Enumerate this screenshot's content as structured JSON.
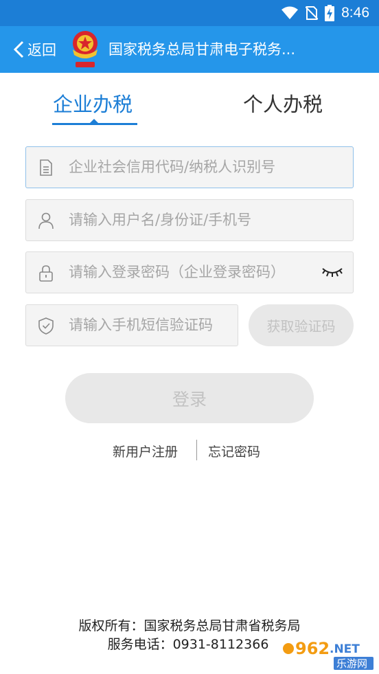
{
  "status": {
    "time": "8:46"
  },
  "header": {
    "back_label": "返回",
    "title": "国家税务总局甘肃电子税务..."
  },
  "tabs": [
    {
      "label": "企业办税",
      "active": true
    },
    {
      "label": "个人办税",
      "active": false
    }
  ],
  "form": {
    "credit_code_placeholder": "企业社会信用代码/纳税人识别号",
    "username_placeholder": "请输入用户名/身份证/手机号",
    "password_placeholder": "请输入登录密码（企业登录密码）",
    "sms_placeholder": "请输入手机短信验证码",
    "sms_button": "获取验证码",
    "login_button": "登录"
  },
  "links": {
    "register": "新用户注册",
    "forgot": "忘记密码"
  },
  "footer": {
    "copyright": "版权所有：国家税务总局甘肃省税务局",
    "phone": "服务电话：0931-8112366"
  },
  "watermark": {
    "brand": "962",
    "suffix": ".NET",
    "sub": "乐游网"
  },
  "colors": {
    "primary": "#2596ea",
    "status_bar": "#1c7ed6",
    "tab_active": "#1c7ed6",
    "button_disabled": "#e8e8e8"
  }
}
